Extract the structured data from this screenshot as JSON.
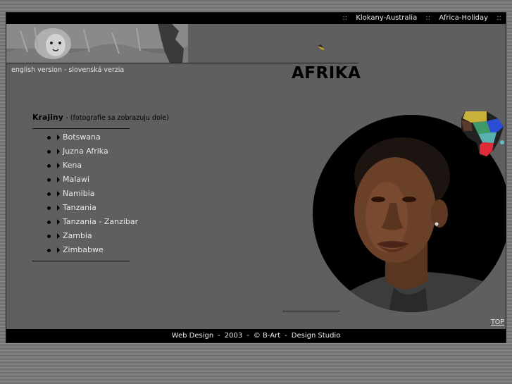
{
  "topnav": {
    "sep": "::",
    "items": [
      "Klokany-Australia",
      "Africa-Holiday"
    ]
  },
  "langs": {
    "english": "english version",
    "dot": "-",
    "slovak": "slovenská verzia"
  },
  "title": "AFRIKA",
  "section": {
    "heading": "Krajiny",
    "note": "- (fotografie sa zobrazuju dole)"
  },
  "countries": [
    "Botswana",
    "Juzna Afrika",
    "Kena",
    "Malawi",
    "Namibia",
    "Tanzania",
    "Tanzania - Zanzibar",
    "Zambia",
    "Zimbabwe"
  ],
  "top_label": "TOP",
  "footer": {
    "design": "Web Design",
    "dash": "-",
    "year": "2003",
    "copy": "© B-Art",
    "studio": "Design Studio"
  },
  "colors": {
    "page_bg": "#5f5f5f",
    "bar_bg": "#000000",
    "link_text": "#e8e8e8"
  }
}
